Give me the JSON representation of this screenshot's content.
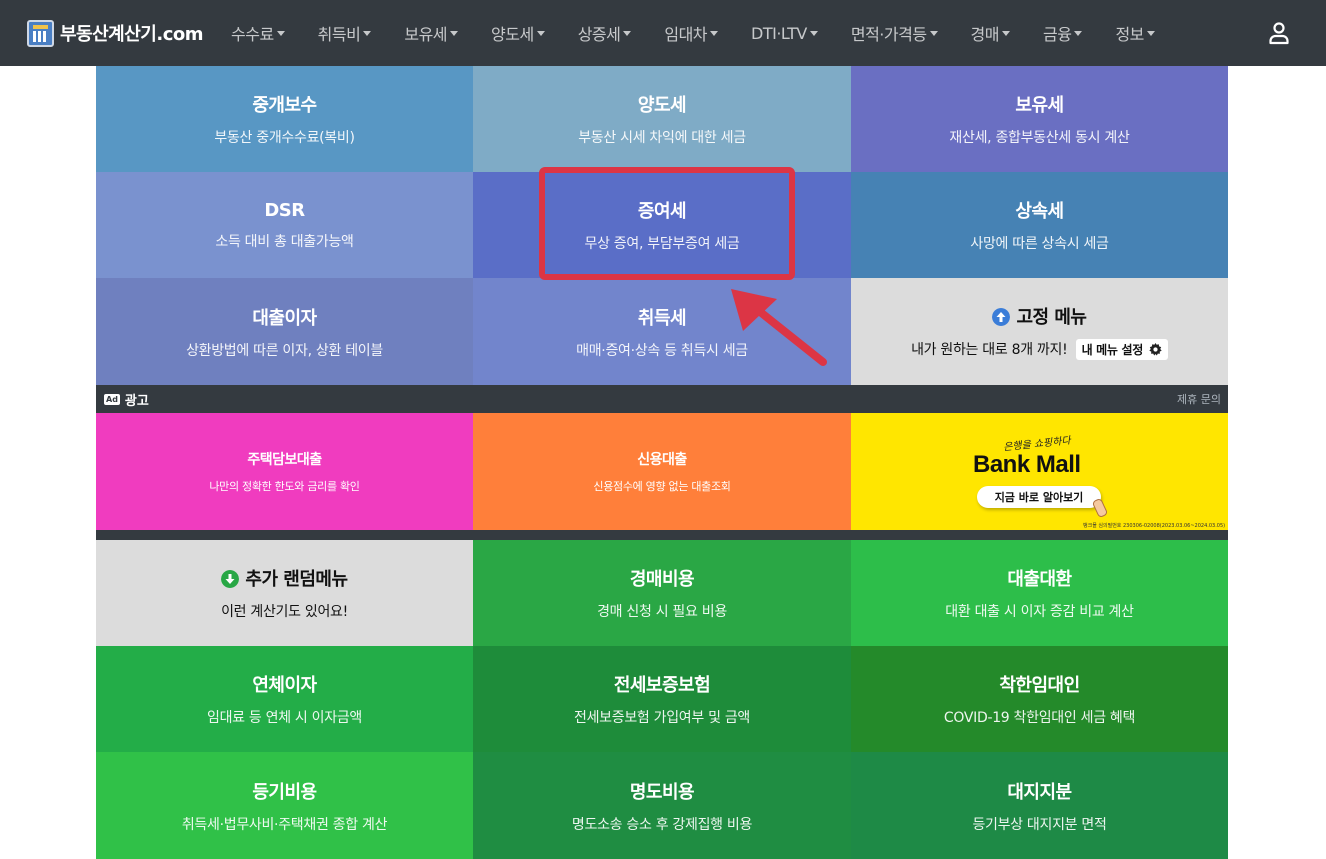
{
  "navbar": {
    "brand": "부동산계산기.com",
    "items": [
      {
        "label": "수수료"
      },
      {
        "label": "취득비"
      },
      {
        "label": "보유세"
      },
      {
        "label": "양도세"
      },
      {
        "label": "상증세"
      },
      {
        "label": "임대차"
      },
      {
        "label": "DTI·LTV"
      },
      {
        "label": "면적·가격등"
      },
      {
        "label": "경매"
      },
      {
        "label": "금융"
      },
      {
        "label": "정보"
      }
    ],
    "user_icon": "user-icon"
  },
  "top_tiles": [
    {
      "title": "중개보수",
      "sub": "부동산 중개수수료(복비)",
      "color": "#5897c4"
    },
    {
      "title": "양도세",
      "sub": "부동산 시세 차익에 대한 세금",
      "color": "#7fabc6"
    },
    {
      "title": "보유세",
      "sub": "재산세, 종합부동산세 동시 계산",
      "color": "#6a6fc2"
    },
    {
      "title": "DSR",
      "sub": "소득 대비 총 대출가능액",
      "color": "#7a92cf"
    },
    {
      "title": "증여세",
      "sub": "무상 증여, 부담부증여 세금",
      "color": "#5a6ec7"
    },
    {
      "title": "상속세",
      "sub": "사망에 따른 상속시 세금",
      "color": "#4682b4"
    },
    {
      "title": "대출이자",
      "sub": "상환방법에 따른 이자, 상환 테이블",
      "color": "#6f80bf"
    },
    {
      "title": "취득세",
      "sub": "매매·증여·상속 등 취득시 세금",
      "color": "#7285cc"
    },
    {
      "title": "고정 메뉴",
      "sub": "내가 원하는 대로 8개 까지!",
      "button": "내 메뉴 설정",
      "icon": "arrow-up-circle-icon",
      "gear_icon": "gear-icon",
      "color": "#dcdcdc"
    }
  ],
  "ad": {
    "badge": "Ad",
    "label": "광고",
    "partner": "제휴 문의",
    "tiles": [
      {
        "title": "주택담보대출",
        "sub": "나만의 정확한 한도와 금리를 확인",
        "color": "#f03cbf"
      },
      {
        "title": "신용대출",
        "sub": "신용점수에 영향 없는 대출조회",
        "color": "#ff7f3a"
      }
    ],
    "bankmall": {
      "script": "은행을 쇼핑하다",
      "title": "Bank Mall",
      "button": "지금 바로 알아보기",
      "fine": "뱅크몰 심의필번호 230306-02008(2023.03.06~2024.03.05)",
      "color": "#ffe600"
    }
  },
  "bottom_tiles": [
    {
      "title": "추가 랜덤메뉴",
      "sub": "이런 계산기도 있어요!",
      "icon": "arrow-down-circle-icon",
      "color": "#dcdcdc"
    },
    {
      "title": "경매비용",
      "sub": "경매 신청 시 필요 비용",
      "color": "#2aa745"
    },
    {
      "title": "대출대환",
      "sub": "대환 대출 시 이자 증감 비교 계산",
      "color": "#2dbe4a"
    },
    {
      "title": "연체이자",
      "sub": "임대료 등 연체 시 이자금액",
      "color": "#23ad48"
    },
    {
      "title": "전세보증보험",
      "sub": "전세보증보험 가입여부 및 금액",
      "color": "#1e8c3a"
    },
    {
      "title": "착한임대인",
      "sub": "COVID-19 착한임대인 세금 혜택",
      "color": "#248a2a"
    },
    {
      "title": "등기비용",
      "sub": "취득세·법무사비·주택채권 종합 계산",
      "color": "#30c148"
    },
    {
      "title": "명도비용",
      "sub": "명도소송 승소 후 강제집행 비용",
      "color": "#1f8d42"
    },
    {
      "title": "대지지분",
      "sub": "등기부상 대지지분 면적",
      "color": "#1e8a46"
    }
  ],
  "annotation": {
    "highlight_color": "#dc3545"
  }
}
